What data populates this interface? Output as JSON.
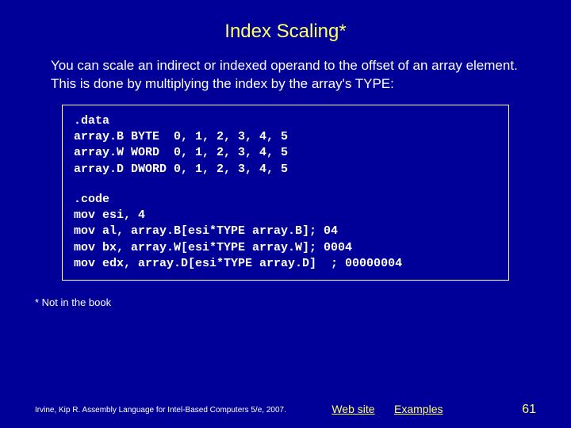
{
  "title": "Index Scaling*",
  "body": "You can scale an indirect or indexed operand to the offset of an array element. This is done by multiplying the index by the array's TYPE:",
  "code": {
    "data_section": ".data\narray.B BYTE  0, 1, 2, 3, 4, 5\narray.W WORD  0, 1, 2, 3, 4, 5\narray.D DWORD 0, 1, 2, 3, 4, 5",
    "code_section": ".code\nmov esi, 4\nmov al, array.B[esi*TYPE array.B]; 04\nmov bx, array.W[esi*TYPE array.W]; 0004\nmov edx, array.D[esi*TYPE array.D]  ; 00000004"
  },
  "footnote": "* Not in the book",
  "footer": {
    "attribution": "Irvine, Kip R. Assembly Language for Intel-Based Computers 5/e, 2007.",
    "link_web": "Web site",
    "link_examples": "Examples",
    "page": "61"
  }
}
